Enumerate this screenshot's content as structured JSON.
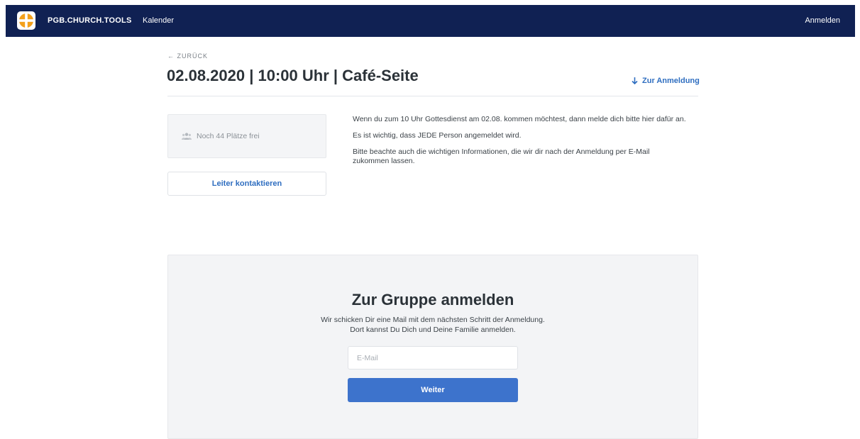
{
  "header": {
    "brand": "PGB.CHURCH.TOOLS",
    "nav_kalender": "Kalender",
    "login_label": "Anmelden",
    "background_color": "#102153"
  },
  "event": {
    "back_label": "← ZURÜCK",
    "title": "02.08.2020 | 10:00 Uhr | Café-Seite",
    "jump_label": "Zur Anmeldung",
    "seats_text": "Noch 44 Plätze frei",
    "contact_label": "Leiter kontaktieren",
    "info": [
      "Wenn du zum 10 Uhr Gottesdienst am 02.08. kommen möchtest, dann melde dich bitte hier dafür an.",
      "Es ist wichtig, dass JEDE Person angemeldet wird.",
      "Bitte beachte auch die wichtigen Informationen, die wir dir nach der Anmeldung per E-Mail zukommen lassen."
    ]
  },
  "signup": {
    "title": "Zur Gruppe anmelden",
    "line1": "Wir schicken Dir eine Mail mit dem nächsten Schritt der Anmeldung.",
    "line2": "Dort kannst Du Dich und Deine Familie anmelden.",
    "email_placeholder": "E-Mail",
    "email_value": "",
    "submit_label": "Weiter"
  },
  "colors": {
    "accent": "#3d73cc",
    "link": "#2f6ec0",
    "logo_orange": "#f3a01b"
  },
  "icons": {
    "logo": "church-logo-icon",
    "arrow_down": "arrow-down-icon",
    "users": "users-icon"
  }
}
